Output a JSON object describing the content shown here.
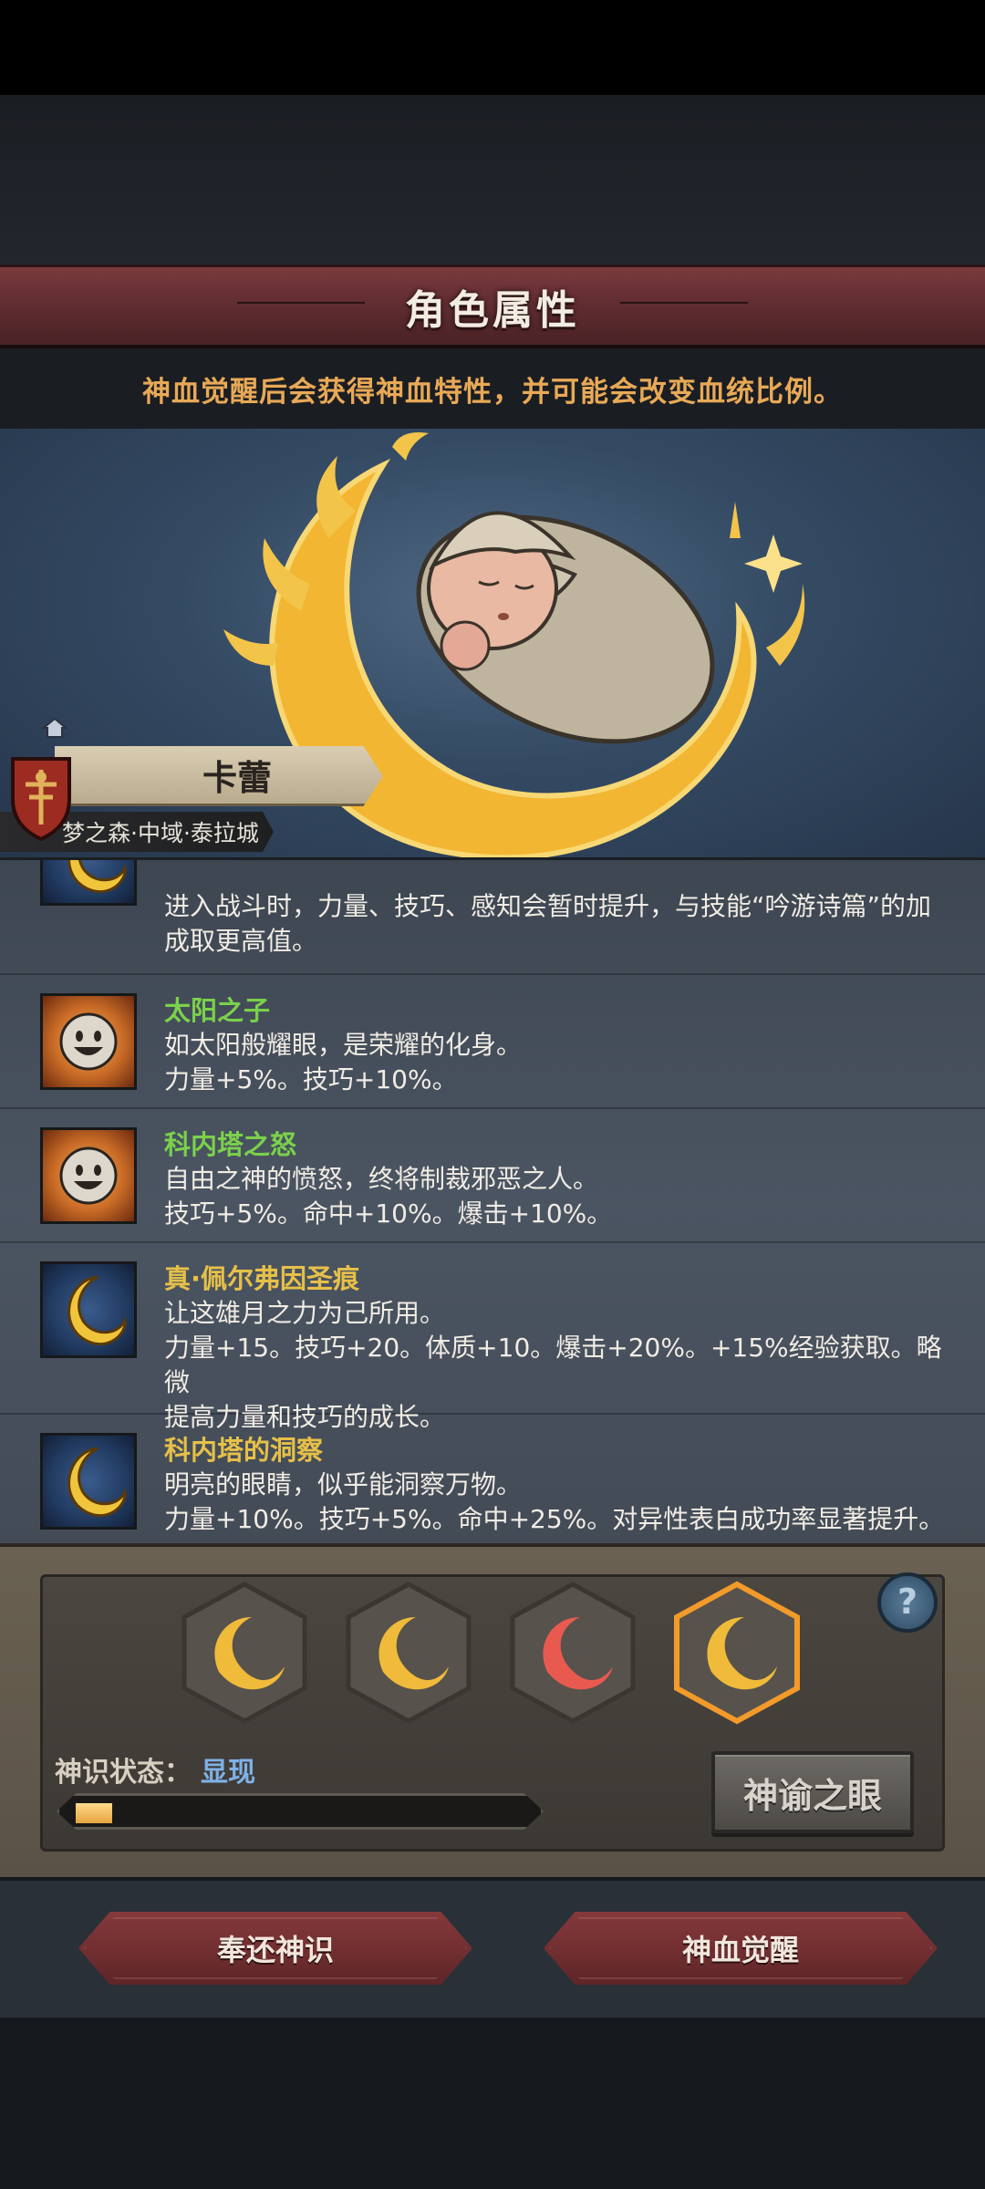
{
  "header": {
    "title": "角色属性"
  },
  "notice": "神血觉醒后会获得神血特性，并可能会改变血统比例。",
  "character": {
    "name": "卡蕾",
    "origin": "梦之森·中域·泰拉城"
  },
  "traits": [
    {
      "name": "",
      "desc_lines": [
        "进入战斗时，力量、技巧、感知会暂时提升，与技能“吟游诗篇”的加",
        "成取更高值。"
      ],
      "icon": "moon-icon",
      "name_color": "gold"
    },
    {
      "name": "太阳之子",
      "desc_lines": [
        "如太阳般耀眼，是荣耀的化身。",
        "力量+5%。技巧+10%。"
      ],
      "icon": "sun-face-icon",
      "name_color": "green"
    },
    {
      "name": "科内塔之怒",
      "desc_lines": [
        "自由之神的愤怒，终将制裁邪恶之人。",
        "技巧+5%。命中+10%。爆击+10%。"
      ],
      "icon": "sun-face-icon",
      "name_color": "green"
    },
    {
      "name": "真·佩尔弗因圣痕",
      "desc_lines": [
        "让这雄月之力为己所用。",
        "力量+15。技巧+20。体质+10。爆击+20%。+15%经验获取。略微",
        "提高力量和技巧的成长。"
      ],
      "icon": "moon-icon",
      "name_color": "gold"
    },
    {
      "name": "科内塔的洞察",
      "desc_lines": [
        "明亮的眼睛，似乎能洞察万物。",
        "力量+10%。技巧+5%。命中+25%。对异性表白成功率显著提升。"
      ],
      "icon": "moon-icon",
      "name_color": "gold"
    }
  ],
  "panel": {
    "help_label": "?",
    "status_label": "神识状态：",
    "status_value": "显现",
    "progress": 0.08,
    "eye_button": "神谕之眼"
  },
  "footer": {
    "left_button": "奉还神识",
    "right_button": "神血觉醒"
  },
  "colors": {
    "accent_red": "#7a3a3d",
    "notice_orange": "#e8a957",
    "trait_green": "#7bd14b",
    "trait_gold": "#e6c048",
    "status_blue": "#7fb1e8"
  }
}
